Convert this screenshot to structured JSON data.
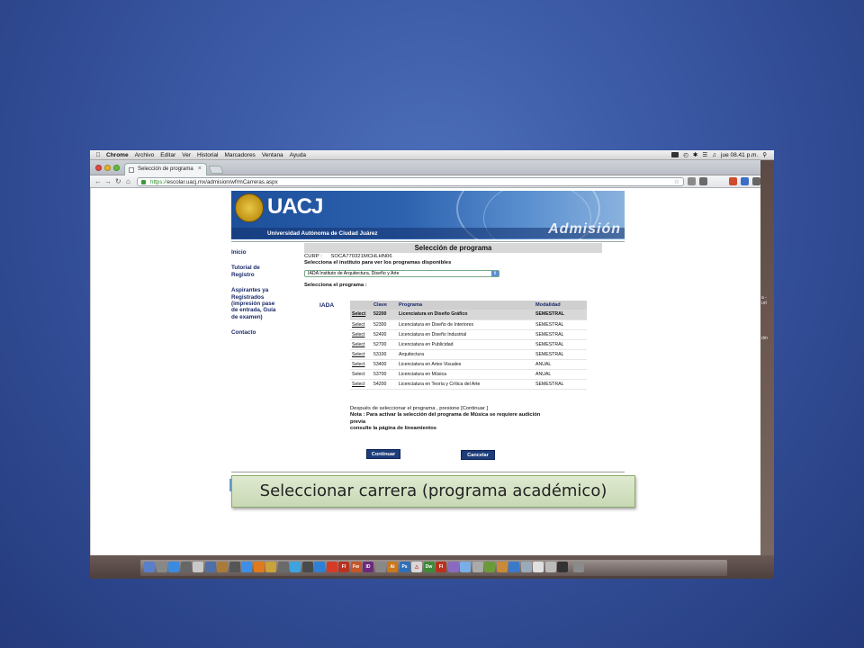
{
  "menubar": {
    "app": "Chrome",
    "items": [
      "Archivo",
      "Editar",
      "Ver",
      "Historial",
      "Marcadores",
      "Ventana",
      "Ayuda"
    ],
    "clock": "jue 08.41 p.m."
  },
  "browser": {
    "tab_title": "Selección de programa",
    "tab_close": "×",
    "url_secure": "https://",
    "url_rest": "escolar.uacj.mx/admision/wfrmCarreras.aspx"
  },
  "banner": {
    "logo_text": "UACJ",
    "university_name": "Universidad Autónoma de Ciudad Juárez",
    "section": "Admisión"
  },
  "sidebar": {
    "items": [
      "Inicio",
      "Tutorial de Registro",
      "Aspirantes ya Registrados (impresión pase de entrada, Guía de examen)",
      "Contacto"
    ]
  },
  "main": {
    "title": "Selección de programa",
    "curp_label": "CURP :",
    "curp_value": "SOCA770321MCHLHN06",
    "instituto_prompt": "Selecciona el instituto para ver los programas disponibles",
    "instituto_value": "IADA Instituto de Arquitectura, Diseño y Arte",
    "programa_prompt": "Selecciona el programa :",
    "instituto_code": "IADA"
  },
  "table": {
    "headers": [
      "",
      "Clave",
      "Programa",
      "Modalidad"
    ],
    "rows": [
      {
        "action": "Select",
        "clave": "52200",
        "programa": "Licenciatura en Diseño Gráfico",
        "modalidad": "SEMESTRAL"
      },
      {
        "action": "Select",
        "clave": "52300",
        "programa": "Licenciatura en Diseño de Interiores",
        "modalidad": "SEMESTRAL"
      },
      {
        "action": "Select",
        "clave": "52400",
        "programa": "Licenciatura en Diseño Industrial",
        "modalidad": "SEMESTRAL"
      },
      {
        "action": "Select",
        "clave": "52700",
        "programa": "Licenciatura en Publicidad",
        "modalidad": "SEMESTRAL"
      },
      {
        "action": "Select",
        "clave": "53100",
        "programa": "Arquitectura",
        "modalidad": "SEMESTRAL"
      },
      {
        "action": "Select",
        "clave": "53400",
        "programa": "Licenciatura en Artes Visuales",
        "modalidad": "ANUAL"
      },
      {
        "action": "Select",
        "clave": "53700",
        "programa": "Licenciatura en Música",
        "modalidad": "ANUAL"
      },
      {
        "action": "Select",
        "clave": "54200",
        "programa": "Licenciatura en Teoría y Crítica del Arte",
        "modalidad": "SEMESTRAL"
      }
    ]
  },
  "notes": {
    "line1": "Después de seleccionar el programa , presione [Continuar ]",
    "line2": "Nota : Para activar la selección del programa de Música se requiere audición previa",
    "line3": "consulte la página de lineamientos"
  },
  "buttons": {
    "continuar": "Continuar",
    "cancelar": "Cancelar"
  },
  "caption": "Seleccionar carrera (programa académico)",
  "colors": {
    "slide_bg": "#3a58a4",
    "uacj_blue": "#1d4f9a",
    "button_navy": "#1d3d7a",
    "caption_green": "#d3e2c2"
  }
}
